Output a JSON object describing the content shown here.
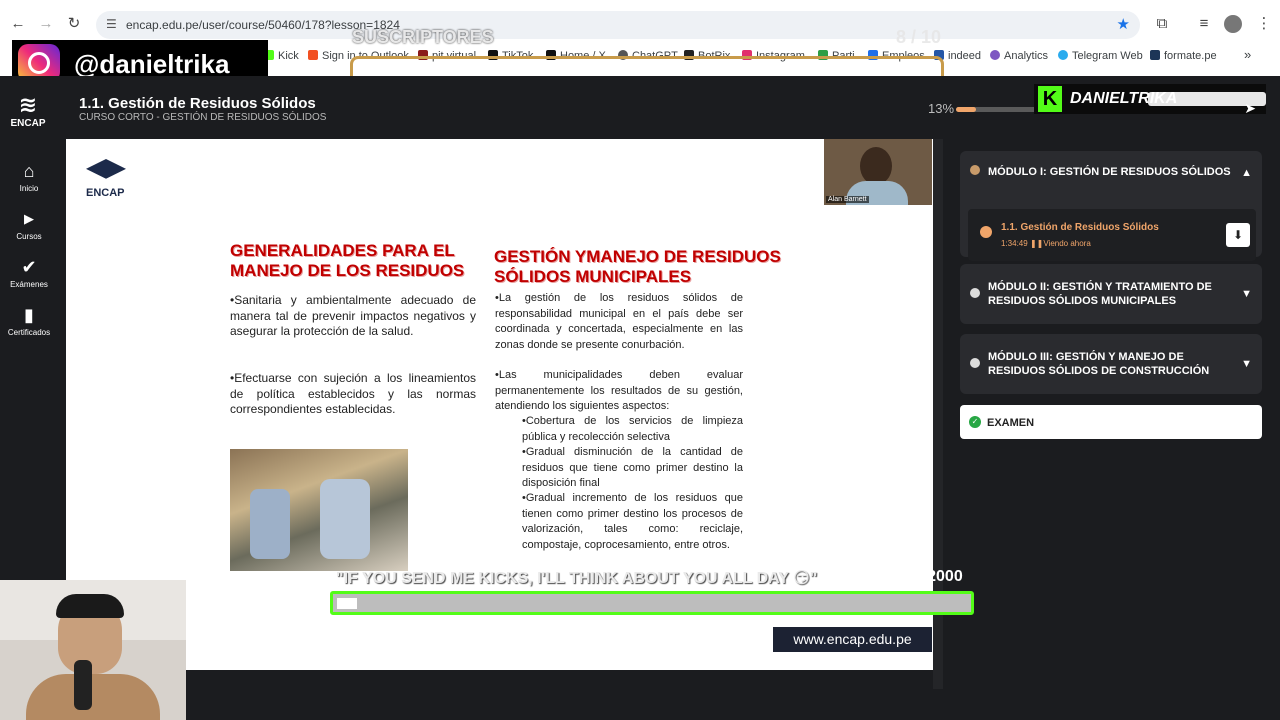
{
  "browser": {
    "url": "encap.edu.pe/user/course/50460/178?lesson=1824",
    "bookmarks": [
      "Kick",
      "Sign in to Outlook",
      "pit virtual",
      "TikTok",
      "Home / X",
      "ChatGPT",
      "BotRix",
      "Instagram",
      "Parti",
      "Empleos",
      "indeed",
      "Analytics",
      "Telegram Web",
      "formate.pe"
    ]
  },
  "overlays": {
    "instagram_handle": "@danieltrika",
    "subs_label": "SUSCRIPTORES",
    "subs_count": "8  / 10",
    "subs_fraction": 0.8,
    "kick_name": "DANIELTRIKA",
    "kicks_message": "\"IF YOU SEND ME KICKS, I'LL THINK ABOUT YOU ALL DAY 😏\"",
    "kicks_count": "91  / 2000"
  },
  "header": {
    "logo_text": "ENCAP",
    "title": "1.1. Gestión de Residuos Sólidos",
    "subtitle": "CURSO CORTO - GESTIÓN DE RESIDUOS SÓLIDOS",
    "progress_label": "13%",
    "progress_value": 0.13
  },
  "sidebar": {
    "items": [
      {
        "label": "Inicio",
        "icon": "home-icon",
        "glyph": "⌂"
      },
      {
        "label": "Cursos",
        "icon": "play-circle-icon",
        "glyph": "▶"
      },
      {
        "label": "Exámenes",
        "icon": "check-icon",
        "glyph": "✔"
      },
      {
        "label": "Certificados",
        "icon": "bookmark-icon",
        "glyph": "▮"
      }
    ]
  },
  "slide": {
    "logo_text": "ENCAP",
    "presenter_name": "Alan Barnett",
    "left_heading": "GENERALIDADES PARA EL MANEJO DE LOS RESIDUOS",
    "left_p1": "•Sanitaria y ambientalmente adecuado de manera tal de prevenir impactos negativos y asegurar la protección de la salud.",
    "left_p2": "•Efectuarse con sujeción a los lineamientos de política establecidos y las normas correspondientes establecidas.",
    "right_heading": "GESTIÓN YMANEJO DE RESIDUOS SÓLIDOS MUNICIPALES",
    "right_p1": "•La gestión de los residuos sólidos de responsabilidad municipal en el país debe ser coordinada y concertada, especialmente en las zonas donde se presente conurbación.",
    "right_p2": "•Las municipalidades deben evaluar permanentemente los resultados de su gestión, atendiendo los siguientes aspectos:",
    "right_b1": "•Cobertura de los servicios de limpieza pública y recolección selectiva",
    "right_b2": "•Gradual disminución de la cantidad de residuos que tiene como primer destino la disposición final",
    "right_b3": "•Gradual incremento de los residuos que tienen como primer destino los procesos de valorización, tales como: reciclaje, compostaje, coprocesamiento, entre otros.",
    "site": "www.encap.edu.pe"
  },
  "modules": [
    {
      "title": "MÓDULO I: GESTIÓN DE RESIDUOS SÓLIDOS",
      "chevron": "▲"
    },
    {
      "title": "MÓDULO II: GESTIÓN Y TRATAMIENTO DE RESIDUOS SÓLIDOS MUNICIPALES",
      "chevron": "▼"
    },
    {
      "title": "MÓDULO III: GESTIÓN Y MANEJO DE RESIDUOS SÓLIDOS DE CONSTRUCCIÓN",
      "chevron": "▼"
    }
  ],
  "lesson": {
    "title": "1.1. Gestión de Residuos Sólidos",
    "duration": "1:34:49",
    "status": "Viendo ahora"
  },
  "exam": {
    "label": "EXAMEN"
  },
  "colors": {
    "accent": "#f0a56a",
    "kick_green": "#53fc18",
    "slide_red": "#c00000"
  }
}
